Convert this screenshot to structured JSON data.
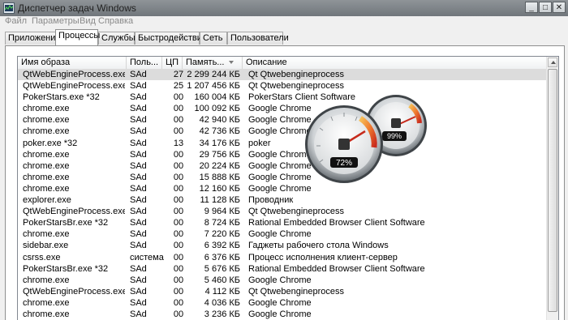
{
  "window": {
    "title": "Диспетчер задач Windows",
    "buttons": [
      "_",
      "□",
      "✕"
    ]
  },
  "menu": [
    "Файл",
    "Параметры",
    "Вид",
    "Справка"
  ],
  "tabs": [
    {
      "label": "Приложения",
      "active": false
    },
    {
      "label": "Процессы",
      "active": true
    },
    {
      "label": "Службы",
      "active": false
    },
    {
      "label": "Быстродействие",
      "active": false
    },
    {
      "label": "Сеть",
      "active": false
    },
    {
      "label": "Пользователи",
      "active": false
    }
  ],
  "columns": {
    "image": "Имя образа",
    "user": "Поль...",
    "cpu": "ЦП",
    "memory": "Память...",
    "description": "Описание"
  },
  "processes": [
    {
      "name": "QtWebEngineProcess.exe *32",
      "user": "SAd",
      "cpu": "27",
      "mem": "2 299 244 КБ",
      "desc": "Qt Qtwebengineprocess",
      "selected": true
    },
    {
      "name": "QtWebEngineProcess.exe *32",
      "user": "SAd",
      "cpu": "25",
      "mem": "1 207 456 КБ",
      "desc": "Qt Qtwebengineprocess"
    },
    {
      "name": "PokerStars.exe *32",
      "user": "SAd",
      "cpu": "00",
      "mem": "160 004 КБ",
      "desc": "PokerStars Client Software"
    },
    {
      "name": "chrome.exe",
      "user": "SAd",
      "cpu": "00",
      "mem": "100 092 КБ",
      "desc": "Google Chrome"
    },
    {
      "name": "chrome.exe",
      "user": "SAd",
      "cpu": "00",
      "mem": "42 940 КБ",
      "desc": "Google Chrome"
    },
    {
      "name": "chrome.exe",
      "user": "SAd",
      "cpu": "00",
      "mem": "42 736 КБ",
      "desc": "Google Chrome"
    },
    {
      "name": "poker.exe *32",
      "user": "SAd",
      "cpu": "13",
      "mem": "34 176 КБ",
      "desc": "poker"
    },
    {
      "name": "chrome.exe",
      "user": "SAd",
      "cpu": "00",
      "mem": "29 756 КБ",
      "desc": "Google Chrome"
    },
    {
      "name": "chrome.exe",
      "user": "SAd",
      "cpu": "00",
      "mem": "20 224 КБ",
      "desc": "Google Chrome"
    },
    {
      "name": "chrome.exe",
      "user": "SAd",
      "cpu": "00",
      "mem": "15 888 КБ",
      "desc": "Google Chrome"
    },
    {
      "name": "chrome.exe",
      "user": "SAd",
      "cpu": "00",
      "mem": "12 160 КБ",
      "desc": "Google Chrome"
    },
    {
      "name": "explorer.exe",
      "user": "SAd",
      "cpu": "00",
      "mem": "11 128 КБ",
      "desc": "Проводник"
    },
    {
      "name": "QtWebEngineProcess.exe *32",
      "user": "SAd",
      "cpu": "00",
      "mem": "9 964 КБ",
      "desc": "Qt Qtwebengineprocess"
    },
    {
      "name": "PokerStarsBr.exe *32",
      "user": "SAd",
      "cpu": "00",
      "mem": "8 724 КБ",
      "desc": "Rational Embedded Browser Client Software"
    },
    {
      "name": "chrome.exe",
      "user": "SAd",
      "cpu": "00",
      "mem": "7 220 КБ",
      "desc": "Google Chrome"
    },
    {
      "name": "sidebar.exe",
      "user": "SAd",
      "cpu": "00",
      "mem": "6 392 КБ",
      "desc": "Гаджеты рабочего стола Windows"
    },
    {
      "name": "csrss.exe",
      "user": "система",
      "cpu": "00",
      "mem": "6 376 КБ",
      "desc": "Процесс исполнения клиент-сервер"
    },
    {
      "name": "PokerStarsBr.exe *32",
      "user": "SAd",
      "cpu": "00",
      "mem": "5 676 КБ",
      "desc": "Rational Embedded Browser Client Software"
    },
    {
      "name": "chrome.exe",
      "user": "SAd",
      "cpu": "00",
      "mem": "5 460 КБ",
      "desc": "Google Chrome"
    },
    {
      "name": "QtWebEngineProcess.exe *32",
      "user": "SAd",
      "cpu": "00",
      "mem": "4 112 КБ",
      "desc": "Qt Qtwebengineprocess"
    },
    {
      "name": "chrome.exe",
      "user": "SAd",
      "cpu": "00",
      "mem": "4 036 КБ",
      "desc": "Google Chrome"
    },
    {
      "name": "chrome.exe",
      "user": "SAd",
      "cpu": "00",
      "mem": "3 236 КБ",
      "desc": "Google Chrome"
    }
  ],
  "gadget": {
    "cpu_percent": 72,
    "memory_percent": 99,
    "cpu_label": "72%",
    "memory_label": "99%"
  }
}
